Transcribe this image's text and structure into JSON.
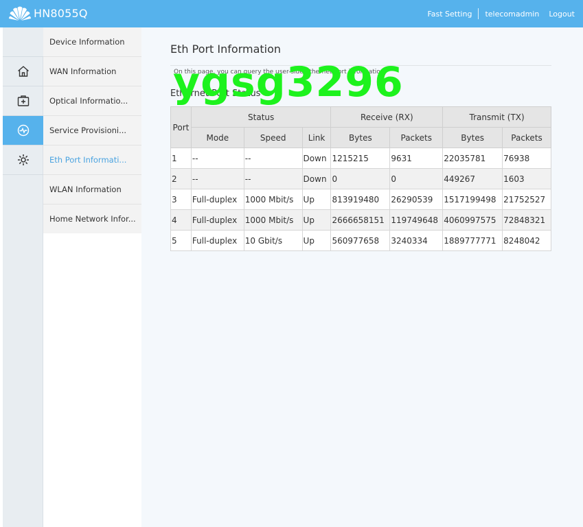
{
  "header": {
    "brand": "HN8055Q",
    "nav": [
      "Fast Setting",
      "telecomadmin",
      "Logout"
    ]
  },
  "leftbar": {
    "icons": [
      "home-icon",
      "add-box-icon",
      "pulse-icon",
      "gear-icon"
    ],
    "active_index": 2
  },
  "submenu": {
    "items": [
      "Device Information",
      "WAN Information",
      "Optical Informatio...",
      "Service Provisioni...",
      "Eth Port Informati...",
      "WLAN Information",
      "Home Network Infor..."
    ],
    "active_index": 4
  },
  "main": {
    "title": "Eth Port Information",
    "description": "On this page, you can query the user-side Ethernet port information.",
    "section_title": "Ethernet Port Status",
    "table": {
      "port_header": "Port",
      "groups": [
        "Status",
        "Receive (RX)",
        "Transmit (TX)"
      ],
      "subheaders": [
        "Mode",
        "Speed",
        "Link",
        "Bytes",
        "Packets",
        "Bytes",
        "Packets"
      ],
      "rows": [
        [
          "1",
          "--",
          "--",
          "Down",
          "1215215",
          "9631",
          "22035781",
          "76938"
        ],
        [
          "2",
          "--",
          "--",
          "Down",
          "0",
          "0",
          "449267",
          "1603"
        ],
        [
          "3",
          "Full-duplex",
          "1000 Mbit/s",
          "Up",
          "813919480",
          "26290539",
          "1517199498",
          "21752527"
        ],
        [
          "4",
          "Full-duplex",
          "1000 Mbit/s",
          "Up",
          "2666658151",
          "119749648",
          "4060997575",
          "72848321"
        ],
        [
          "5",
          "Full-duplex",
          "10 Gbit/s",
          "Up",
          "560977658",
          "3240334",
          "1889777771",
          "8248042"
        ]
      ]
    }
  },
  "watermark": "ygsg3296",
  "colors": {
    "accent": "#56b2ec",
    "active_link": "#4aa3e0",
    "watermark": "#1df21d"
  }
}
